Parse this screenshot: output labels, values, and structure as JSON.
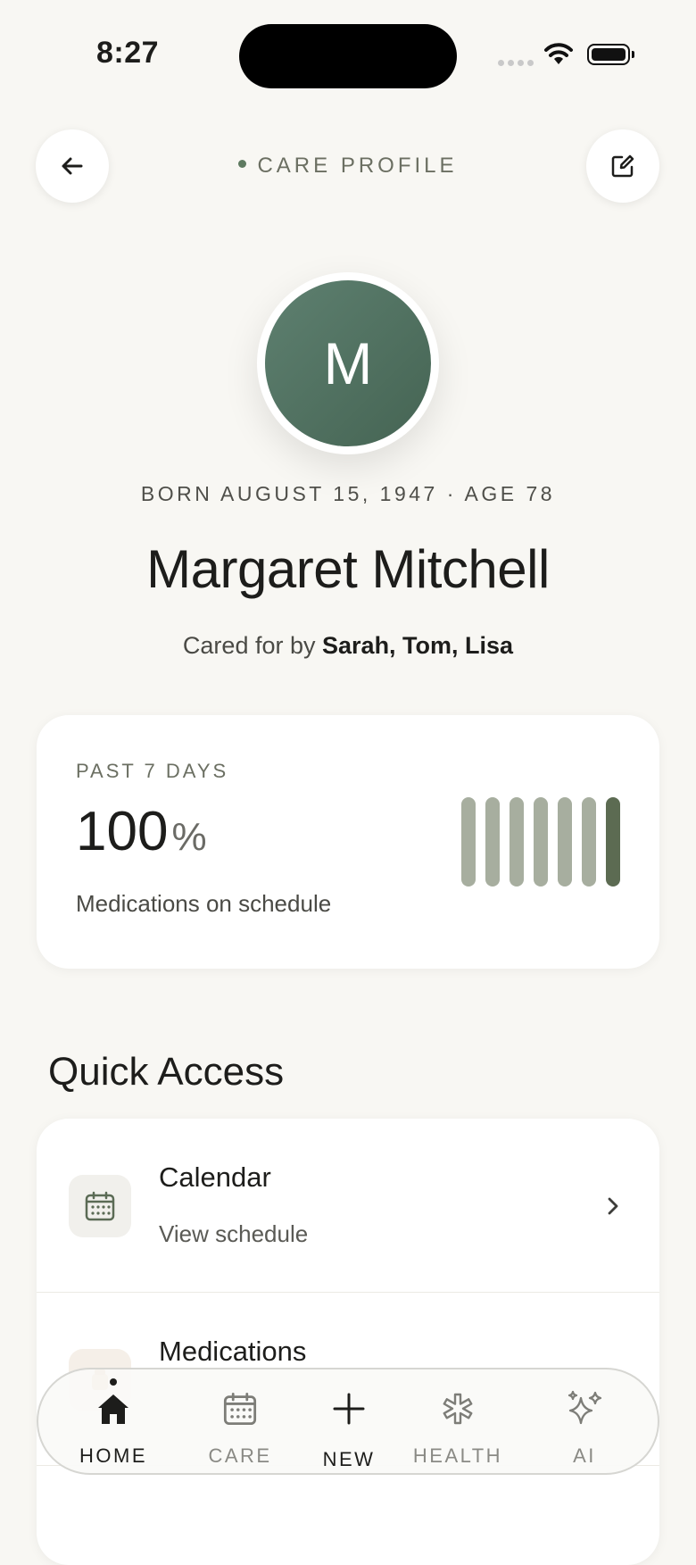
{
  "status": {
    "time": "8:27"
  },
  "header": {
    "title": "CARE PROFILE"
  },
  "profile": {
    "initial": "M",
    "born": "BORN AUGUST 15, 1947 · AGE 78",
    "name": "Margaret Mitchell",
    "cared_prefix": "Cared for by",
    "caregivers": "Sarah, Tom, Lisa"
  },
  "adherence": {
    "label": "PAST 7 DAYS",
    "value": "100",
    "unit": "%",
    "subtitle": "Medications on schedule",
    "days_on_schedule": [
      1,
      1,
      1,
      1,
      1,
      1,
      1
    ],
    "bar_color": "#a7ae9f",
    "today_color": "#5c6b52"
  },
  "quick_access": {
    "title": "Quick Access",
    "items": [
      {
        "title": "Calendar",
        "subtitle": "View schedule",
        "icon": "calendar-icon"
      },
      {
        "title": "Medications",
        "subtitle": "",
        "icon": "pill-icon"
      }
    ]
  },
  "nav": {
    "items": [
      {
        "label": "HOME",
        "icon": "home-icon",
        "active": true
      },
      {
        "label": "CARE",
        "icon": "calendar-icon",
        "active": false
      },
      {
        "label": "NEW",
        "icon": "plus-icon",
        "active": false
      },
      {
        "label": "HEALTH",
        "icon": "medical-star-icon",
        "active": false
      },
      {
        "label": "AI",
        "icon": "sparkles-icon",
        "active": false
      }
    ]
  },
  "colors": {
    "accent": "#5e7a60",
    "avatar": "#4f7060",
    "background": "#f8f7f3"
  }
}
